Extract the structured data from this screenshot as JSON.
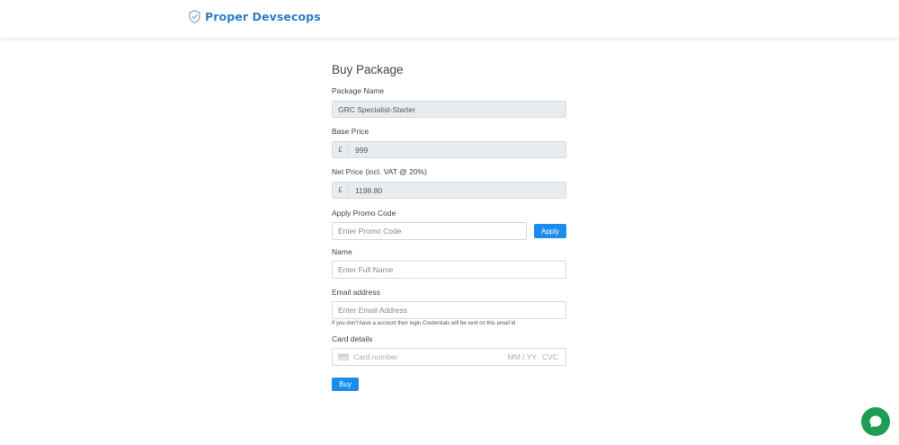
{
  "header": {
    "brand": "Proper Devsecops"
  },
  "form": {
    "title": "Buy Package",
    "package_name": {
      "label": "Package Name",
      "value": "GRC Specialist-Starter"
    },
    "base_price": {
      "label": "Base Price",
      "currency": "£",
      "value": "999"
    },
    "net_price": {
      "label": "Net Price (incl. VAT @ 20%)",
      "currency": "£",
      "value": "1198.80"
    },
    "promo": {
      "label": "Apply Promo Code",
      "placeholder": "Enter Promo Code",
      "button": "Apply"
    },
    "name": {
      "label": "Name",
      "placeholder": "Enter Full Name"
    },
    "email": {
      "label": "Email address",
      "placeholder": "Enter Email Address",
      "hint": "If you don't have a account then login Credentials will be sent on this email id."
    },
    "card": {
      "label": "Card details",
      "number_placeholder": "Card number",
      "expiry_placeholder": "MM / YY",
      "cvc_placeholder": "CVC"
    },
    "buy_button": "Buy"
  },
  "colors": {
    "brand": "#2a7fc9",
    "button": "#1a8cf0",
    "chat": "#1f9d55"
  },
  "icons": {
    "brand": "shield-logo-icon",
    "card": "credit-card-icon",
    "chat": "chat-bubble-icon"
  }
}
